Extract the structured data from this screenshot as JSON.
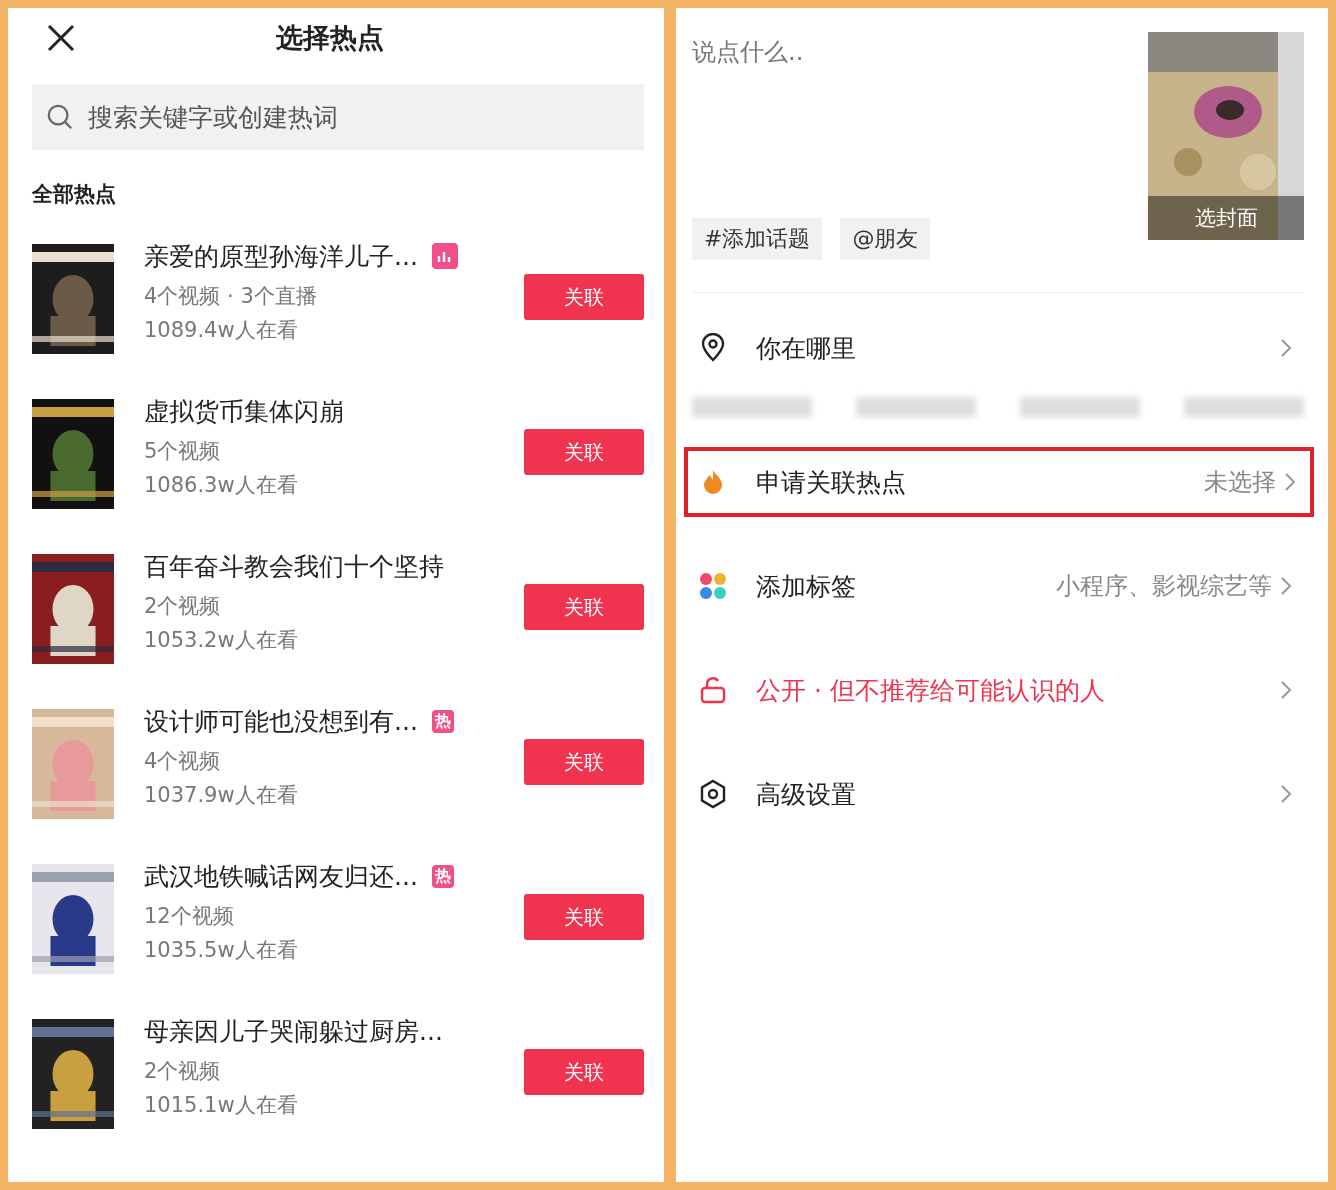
{
  "left": {
    "title": "选择热点",
    "search": {
      "placeholder": "搜索关键字或创建热词"
    },
    "section_title": "全部热点",
    "topics": [
      {
        "title": "亲爱的原型孙海洋儿子...",
        "badge": {
          "kind": "trend"
        },
        "meta": "4个视频 · 3个直播",
        "viewers": "1089.4w人在看",
        "button": "关联"
      },
      {
        "title": "虚拟货币集体闪崩",
        "meta": "5个视频",
        "viewers": "1086.3w人在看",
        "button": "关联"
      },
      {
        "title": "百年奋斗教会我们十个坚持",
        "meta": "2个视频",
        "viewers": "1053.2w人在看",
        "button": "关联"
      },
      {
        "title": "设计师可能也没想到有...",
        "badge": {
          "kind": "hot",
          "text": "热"
        },
        "meta": "4个视频",
        "viewers": "1037.9w人在看",
        "button": "关联"
      },
      {
        "title": "武汉地铁喊话网友归还...",
        "badge": {
          "kind": "hot",
          "text": "热"
        },
        "meta": "12个视频",
        "viewers": "1035.5w人在看",
        "button": "关联"
      },
      {
        "title": "母亲因儿子哭闹躲过厨房...",
        "meta": "2个视频",
        "viewers": "1015.1w人在看",
        "button": "关联"
      }
    ]
  },
  "right": {
    "caption": {
      "placeholder": "说点什么.."
    },
    "cover_label": "选封面",
    "chips": [
      "#添加话题",
      "@朋友"
    ],
    "rows": [
      {
        "kind": "location",
        "label": "你在哪里",
        "highlighted": false
      },
      {
        "kind": "hotspot",
        "label": "申请关联热点",
        "value": "未选择",
        "highlighted": true
      },
      {
        "kind": "tags",
        "label": "添加标签",
        "value": "小程序、影视综艺等",
        "highlighted": false
      },
      {
        "kind": "privacy",
        "label": "公开 · 但不推荐给可能认识的人",
        "highlighted": false
      },
      {
        "kind": "settings",
        "label": "高级设置",
        "highlighted": false
      }
    ]
  }
}
